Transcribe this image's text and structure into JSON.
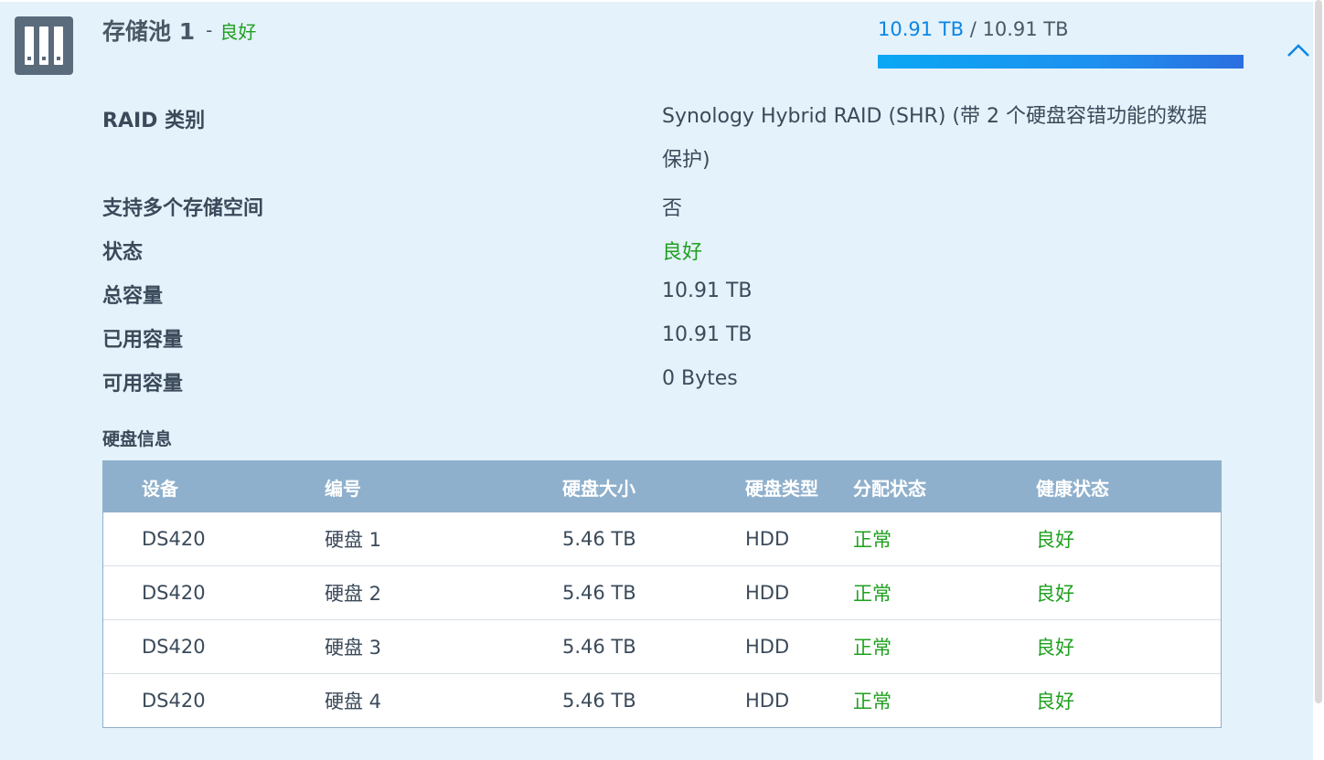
{
  "pool": {
    "name": "存储池 1",
    "separator": "-",
    "status": "良好",
    "icon": "storage-pool-icon",
    "usage": {
      "used": "10.91 TB",
      "separator": "/",
      "total": "10.91 TB",
      "fraction": 1.0
    },
    "collapse_icon": "chevron-up-icon"
  },
  "info": [
    {
      "label": "RAID 类别",
      "value": "Synology Hybrid RAID (SHR) (带 2 个硬盘容错功能的数据保护)"
    },
    {
      "label": "支持多个存储空间",
      "value": "否"
    },
    {
      "label": "状态",
      "value": "良好"
    },
    {
      "label": "总容量",
      "value": "10.91 TB"
    },
    {
      "label": "已用容量",
      "value": "10.91 TB"
    },
    {
      "label": "可用容量",
      "value": "0 Bytes"
    }
  ],
  "disk_section_title": "硬盘信息",
  "disk_table": {
    "headers": [
      "设备",
      "编号",
      "硬盘大小",
      "硬盘类型",
      "分配状态",
      "健康状态"
    ],
    "rows": [
      [
        "DS420",
        "硬盘 1",
        "5.46 TB",
        "HDD",
        "正常",
        "良好"
      ],
      [
        "DS420",
        "硬盘 2",
        "5.46 TB",
        "HDD",
        "正常",
        "良好"
      ],
      [
        "DS420",
        "硬盘 3",
        "5.46 TB",
        "HDD",
        "正常",
        "良好"
      ],
      [
        "DS420",
        "硬盘 4",
        "5.46 TB",
        "HDD",
        "正常",
        "良好"
      ]
    ]
  },
  "colors": {
    "good": "#1fa01f",
    "accent": "#0b86e3",
    "header_bg": "#8fb0cc",
    "panel_bg": "#e4f2fb"
  }
}
